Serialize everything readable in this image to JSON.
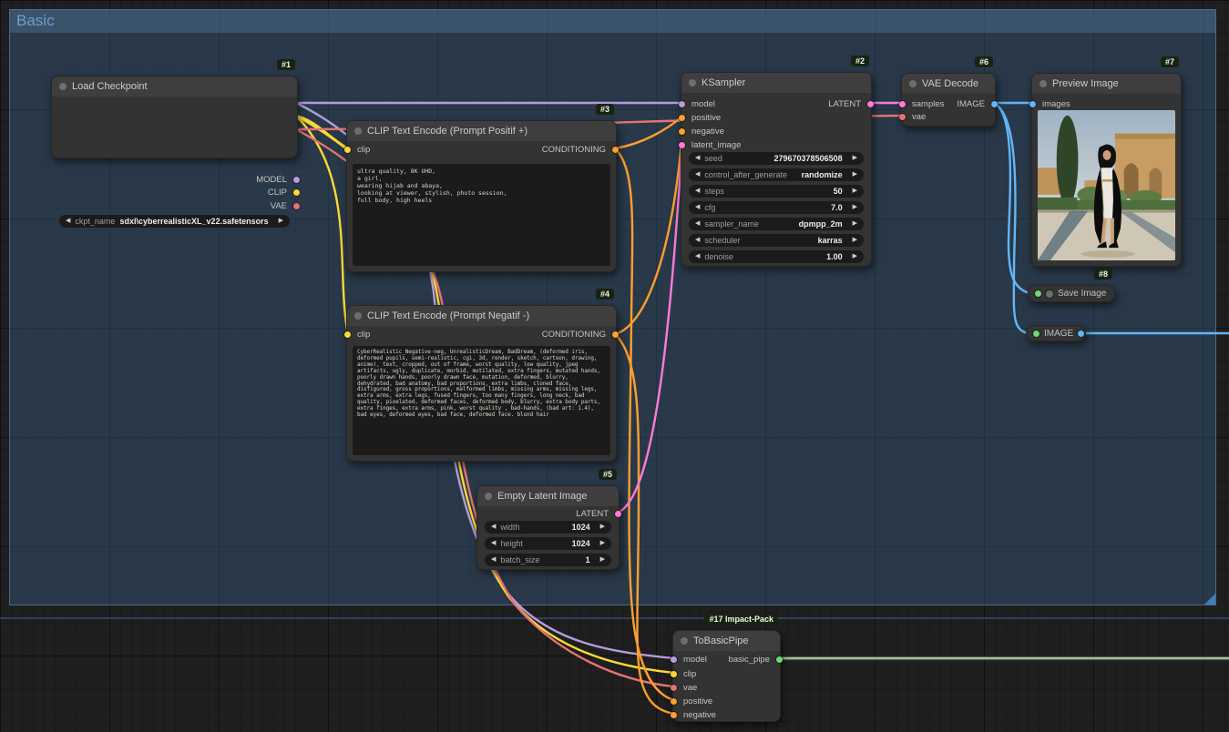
{
  "group": {
    "title": "Basic"
  },
  "colors": {
    "model": "#b39ddb",
    "clip": "#fdd835",
    "vae": "#e57373",
    "conditioning": "#ff9f2e",
    "latent": "#ff7bd7",
    "image": "#64b5f6",
    "pipe_wire": "#a8bfa2",
    "pipe_wire_dark": "#44503f",
    "cross_wire": "#2e4d6e",
    "pipe_dot": "#71d971"
  },
  "nodes": {
    "load_checkpoint": {
      "badge": "#1",
      "title": "Load Checkpoint",
      "outputs": [
        "MODEL",
        "CLIP",
        "VAE"
      ],
      "widgets": [
        {
          "label": "ckpt_name",
          "value": "sdxl\\cyberrealisticXL_v22.safetensors"
        }
      ]
    },
    "clip_pos": {
      "badge": "#3",
      "title": "CLIP Text Encode (Prompt Positif +)",
      "inputs": [
        "clip"
      ],
      "outputs": [
        "CONDITIONING"
      ],
      "text": "ultra quality, 8K UHD,\na girl,\nwearing hijab and abaya,\nlooking at viewer, stylish, photo session,\nfull body, high heels"
    },
    "clip_neg": {
      "badge": "#4",
      "title": "CLIP Text Encode (Prompt Negatif -)",
      "inputs": [
        "clip"
      ],
      "outputs": [
        "CONDITIONING"
      ],
      "text": "CyberRealistic_Negative-neg, UnrealisticDream, BadDream, (deformed iris, deformed pupils, semi-realistic, cgi, 3d, render, sketch, cartoon, drawing, anime), text, cropped, out of frame, worst quality, low quality, jpeg artifacts, ugly, duplicate, morbid, mutilated, extra fingers, mutated hands, poorly drawn hands, poorly drawn face, mutation, deformed, blurry, dehydrated, bad anatomy, bad proportions, extra limbs, cloned face, disfigured, gross proportions, malformed limbs, missing arms, missing legs, extra arms, extra legs, fused fingers, too many fingers, long neck, bad quality, pixelated, deformed faces, deformed body, blurry, extra body parts, extra finges, extra arms, pink, worst quality , bad-hands, (bad art: 1.4), bad eyes, deformed eyes, bad face, deformed face. blond hair"
    },
    "empty_latent": {
      "badge": "#5",
      "title": "Empty Latent Image",
      "outputs": [
        "LATENT"
      ],
      "widgets": [
        {
          "label": "width",
          "value": "1024"
        },
        {
          "label": "height",
          "value": "1024"
        },
        {
          "label": "batch_size",
          "value": "1"
        }
      ]
    },
    "ksampler": {
      "badge": "#2",
      "title": "KSampler",
      "inputs": [
        "model",
        "positive",
        "negative",
        "latent_image"
      ],
      "outputs": [
        "LATENT"
      ],
      "widgets": [
        {
          "label": "seed",
          "value": "279670378506508"
        },
        {
          "label": "control_after_generate",
          "value": "randomize"
        },
        {
          "label": "steps",
          "value": "50"
        },
        {
          "label": "cfg",
          "value": "7.0"
        },
        {
          "label": "sampler_name",
          "value": "dpmpp_2m"
        },
        {
          "label": "scheduler",
          "value": "karras"
        },
        {
          "label": "denoise",
          "value": "1.00"
        }
      ]
    },
    "vae_decode": {
      "badge": "#6",
      "title": "VAE Decode",
      "inputs": [
        "samples",
        "vae"
      ],
      "outputs": [
        "IMAGE"
      ]
    },
    "preview": {
      "badge": "#7",
      "title": "Preview Image",
      "inputs": [
        "images"
      ]
    },
    "save_image": {
      "badge": "#8",
      "title": "Save Image"
    },
    "image_reroute": {
      "title": "IMAGE"
    },
    "tobasicpipe": {
      "badge": "#17 Impact-Pack",
      "title": "ToBasicPipe",
      "inputs": [
        "model",
        "clip",
        "vae",
        "positive",
        "negative"
      ],
      "outputs": [
        "basic_pipe"
      ]
    }
  }
}
